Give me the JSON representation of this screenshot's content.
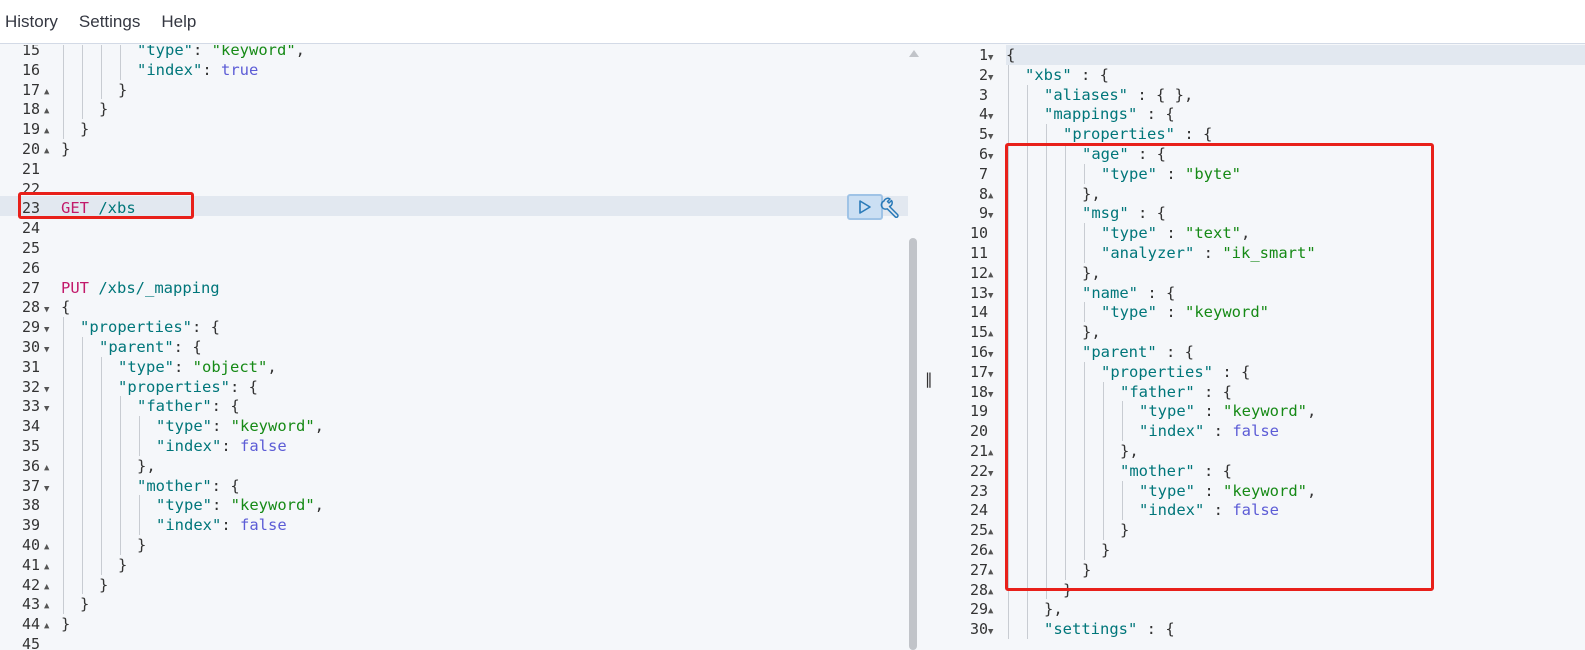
{
  "menubar": {
    "items": [
      "History",
      "Settings",
      "Help"
    ]
  },
  "colors": {
    "key": "#00767a",
    "string": "#168a16",
    "bool": "#5c5cd6",
    "method": "#c21a6b",
    "highlight_box": "#e8201a",
    "active_line": "#e2e8f0"
  },
  "left_editor": {
    "lines": [
      {
        "n": "15",
        "fold": "",
        "indent": 4,
        "tokens": [
          [
            "k",
            "\"type\""
          ],
          [
            "p",
            ": "
          ],
          [
            "s",
            "\"keyword\""
          ],
          [
            "p",
            ","
          ]
        ]
      },
      {
        "n": "16",
        "fold": "",
        "indent": 4,
        "tokens": [
          [
            "k",
            "\"index\""
          ],
          [
            "p",
            ": "
          ],
          [
            "b",
            "true"
          ]
        ]
      },
      {
        "n": "17",
        "fold": "up",
        "indent": 3,
        "tokens": [
          [
            "p",
            "}"
          ]
        ]
      },
      {
        "n": "18",
        "fold": "up",
        "indent": 2,
        "tokens": [
          [
            "p",
            "}"
          ]
        ]
      },
      {
        "n": "19",
        "fold": "up",
        "indent": 1,
        "tokens": [
          [
            "p",
            "}"
          ]
        ]
      },
      {
        "n": "20",
        "fold": "up",
        "indent": 0,
        "tokens": [
          [
            "p",
            "}"
          ]
        ]
      },
      {
        "n": "21",
        "fold": "",
        "indent": 0,
        "tokens": []
      },
      {
        "n": "22",
        "fold": "",
        "indent": 0,
        "tokens": []
      },
      {
        "n": "23",
        "fold": "",
        "indent": 0,
        "tokens": [
          [
            "m",
            "GET "
          ],
          [
            "u",
            "/xbs"
          ]
        ]
      },
      {
        "n": "24",
        "fold": "",
        "indent": 0,
        "tokens": []
      },
      {
        "n": "25",
        "fold": "",
        "indent": 0,
        "tokens": []
      },
      {
        "n": "26",
        "fold": "",
        "indent": 0,
        "tokens": []
      },
      {
        "n": "27",
        "fold": "",
        "indent": 0,
        "tokens": [
          [
            "m",
            "PUT "
          ],
          [
            "u",
            "/xbs/_mapping"
          ]
        ]
      },
      {
        "n": "28",
        "fold": "down",
        "indent": 0,
        "tokens": [
          [
            "p",
            "{"
          ]
        ]
      },
      {
        "n": "29",
        "fold": "down",
        "indent": 1,
        "tokens": [
          [
            "k",
            "\"properties\""
          ],
          [
            "p",
            ": {"
          ]
        ]
      },
      {
        "n": "30",
        "fold": "down",
        "indent": 2,
        "tokens": [
          [
            "k",
            "\"parent\""
          ],
          [
            "p",
            ": {"
          ]
        ]
      },
      {
        "n": "31",
        "fold": "",
        "indent": 3,
        "tokens": [
          [
            "k",
            "\"type\""
          ],
          [
            "p",
            ": "
          ],
          [
            "s",
            "\"object\""
          ],
          [
            "p",
            ","
          ]
        ]
      },
      {
        "n": "32",
        "fold": "down",
        "indent": 3,
        "tokens": [
          [
            "k",
            "\"properties\""
          ],
          [
            "p",
            ": {"
          ]
        ]
      },
      {
        "n": "33",
        "fold": "down",
        "indent": 4,
        "tokens": [
          [
            "k",
            "\"father\""
          ],
          [
            "p",
            ": {"
          ]
        ]
      },
      {
        "n": "34",
        "fold": "",
        "indent": 5,
        "tokens": [
          [
            "k",
            "\"type\""
          ],
          [
            "p",
            ": "
          ],
          [
            "s",
            "\"keyword\""
          ],
          [
            "p",
            ","
          ]
        ]
      },
      {
        "n": "35",
        "fold": "",
        "indent": 5,
        "tokens": [
          [
            "k",
            "\"index\""
          ],
          [
            "p",
            ": "
          ],
          [
            "b",
            "false"
          ]
        ]
      },
      {
        "n": "36",
        "fold": "up",
        "indent": 4,
        "tokens": [
          [
            "p",
            "},"
          ]
        ]
      },
      {
        "n": "37",
        "fold": "down",
        "indent": 4,
        "tokens": [
          [
            "k",
            "\"mother\""
          ],
          [
            "p",
            ": {"
          ]
        ]
      },
      {
        "n": "38",
        "fold": "",
        "indent": 5,
        "tokens": [
          [
            "k",
            "\"type\""
          ],
          [
            "p",
            ": "
          ],
          [
            "s",
            "\"keyword\""
          ],
          [
            "p",
            ","
          ]
        ]
      },
      {
        "n": "39",
        "fold": "",
        "indent": 5,
        "tokens": [
          [
            "k",
            "\"index\""
          ],
          [
            "p",
            ": "
          ],
          [
            "b",
            "false"
          ]
        ]
      },
      {
        "n": "40",
        "fold": "up",
        "indent": 4,
        "tokens": [
          [
            "p",
            "}"
          ]
        ]
      },
      {
        "n": "41",
        "fold": "up",
        "indent": 3,
        "tokens": [
          [
            "p",
            "}"
          ]
        ]
      },
      {
        "n": "42",
        "fold": "up",
        "indent": 2,
        "tokens": [
          [
            "p",
            "}"
          ]
        ]
      },
      {
        "n": "43",
        "fold": "up",
        "indent": 1,
        "tokens": [
          [
            "p",
            "}"
          ]
        ]
      },
      {
        "n": "44",
        "fold": "up",
        "indent": 0,
        "tokens": [
          [
            "p",
            "}"
          ]
        ]
      },
      {
        "n": "45",
        "fold": "",
        "indent": 0,
        "tokens": []
      }
    ]
  },
  "right_editor": {
    "lines": [
      {
        "n": "1",
        "fold": "down",
        "indent": 0,
        "tokens": [
          [
            "p",
            "{"
          ]
        ]
      },
      {
        "n": "2",
        "fold": "down",
        "indent": 1,
        "tokens": [
          [
            "k",
            "\"xbs\""
          ],
          [
            "p",
            " : {"
          ]
        ]
      },
      {
        "n": "3",
        "fold": "",
        "indent": 2,
        "tokens": [
          [
            "k",
            "\"aliases\""
          ],
          [
            "p",
            " : { },"
          ]
        ]
      },
      {
        "n": "4",
        "fold": "down",
        "indent": 2,
        "tokens": [
          [
            "k",
            "\"mappings\""
          ],
          [
            "p",
            " : {"
          ]
        ]
      },
      {
        "n": "5",
        "fold": "down",
        "indent": 3,
        "tokens": [
          [
            "k",
            "\"properties\""
          ],
          [
            "p",
            " : {"
          ]
        ]
      },
      {
        "n": "6",
        "fold": "down",
        "indent": 4,
        "tokens": [
          [
            "k",
            "\"age\""
          ],
          [
            "p",
            " : {"
          ]
        ]
      },
      {
        "n": "7",
        "fold": "",
        "indent": 5,
        "tokens": [
          [
            "k",
            "\"type\""
          ],
          [
            "p",
            " : "
          ],
          [
            "s",
            "\"byte\""
          ]
        ]
      },
      {
        "n": "8",
        "fold": "up",
        "indent": 4,
        "tokens": [
          [
            "p",
            "},"
          ]
        ]
      },
      {
        "n": "9",
        "fold": "down",
        "indent": 4,
        "tokens": [
          [
            "k",
            "\"msg\""
          ],
          [
            "p",
            " : {"
          ]
        ]
      },
      {
        "n": "10",
        "fold": "",
        "indent": 5,
        "tokens": [
          [
            "k",
            "\"type\""
          ],
          [
            "p",
            " : "
          ],
          [
            "s",
            "\"text\""
          ],
          [
            "p",
            ","
          ]
        ]
      },
      {
        "n": "11",
        "fold": "",
        "indent": 5,
        "tokens": [
          [
            "k",
            "\"analyzer\""
          ],
          [
            "p",
            " : "
          ],
          [
            "s",
            "\"ik_smart\""
          ]
        ]
      },
      {
        "n": "12",
        "fold": "up",
        "indent": 4,
        "tokens": [
          [
            "p",
            "},"
          ]
        ]
      },
      {
        "n": "13",
        "fold": "down",
        "indent": 4,
        "tokens": [
          [
            "k",
            "\"name\""
          ],
          [
            "p",
            " : {"
          ]
        ]
      },
      {
        "n": "14",
        "fold": "",
        "indent": 5,
        "tokens": [
          [
            "k",
            "\"type\""
          ],
          [
            "p",
            " : "
          ],
          [
            "s",
            "\"keyword\""
          ]
        ]
      },
      {
        "n": "15",
        "fold": "up",
        "indent": 4,
        "tokens": [
          [
            "p",
            "},"
          ]
        ]
      },
      {
        "n": "16",
        "fold": "down",
        "indent": 4,
        "tokens": [
          [
            "k",
            "\"parent\""
          ],
          [
            "p",
            " : {"
          ]
        ]
      },
      {
        "n": "17",
        "fold": "down",
        "indent": 5,
        "tokens": [
          [
            "k",
            "\"properties\""
          ],
          [
            "p",
            " : {"
          ]
        ]
      },
      {
        "n": "18",
        "fold": "down",
        "indent": 6,
        "tokens": [
          [
            "k",
            "\"father\""
          ],
          [
            "p",
            " : {"
          ]
        ]
      },
      {
        "n": "19",
        "fold": "",
        "indent": 7,
        "tokens": [
          [
            "k",
            "\"type\""
          ],
          [
            "p",
            " : "
          ],
          [
            "s",
            "\"keyword\""
          ],
          [
            "p",
            ","
          ]
        ]
      },
      {
        "n": "20",
        "fold": "",
        "indent": 7,
        "tokens": [
          [
            "k",
            "\"index\""
          ],
          [
            "p",
            " : "
          ],
          [
            "b",
            "false"
          ]
        ]
      },
      {
        "n": "21",
        "fold": "up",
        "indent": 6,
        "tokens": [
          [
            "p",
            "},"
          ]
        ]
      },
      {
        "n": "22",
        "fold": "down",
        "indent": 6,
        "tokens": [
          [
            "k",
            "\"mother\""
          ],
          [
            "p",
            " : {"
          ]
        ]
      },
      {
        "n": "23",
        "fold": "",
        "indent": 7,
        "tokens": [
          [
            "k",
            "\"type\""
          ],
          [
            "p",
            " : "
          ],
          [
            "s",
            "\"keyword\""
          ],
          [
            "p",
            ","
          ]
        ]
      },
      {
        "n": "24",
        "fold": "",
        "indent": 7,
        "tokens": [
          [
            "k",
            "\"index\""
          ],
          [
            "p",
            " : "
          ],
          [
            "b",
            "false"
          ]
        ]
      },
      {
        "n": "25",
        "fold": "up",
        "indent": 6,
        "tokens": [
          [
            "p",
            "}"
          ]
        ]
      },
      {
        "n": "26",
        "fold": "up",
        "indent": 5,
        "tokens": [
          [
            "p",
            "}"
          ]
        ]
      },
      {
        "n": "27",
        "fold": "up",
        "indent": 4,
        "tokens": [
          [
            "p",
            "}"
          ]
        ]
      },
      {
        "n": "28",
        "fold": "up",
        "indent": 3,
        "tokens": [
          [
            "p",
            "}"
          ]
        ]
      },
      {
        "n": "29",
        "fold": "up",
        "indent": 2,
        "tokens": [
          [
            "p",
            "},"
          ]
        ]
      },
      {
        "n": "30",
        "fold": "down",
        "indent": 2,
        "tokens": [
          [
            "k",
            "\"settings\""
          ],
          [
            "p",
            " : {"
          ]
        ]
      }
    ]
  },
  "actions": {
    "run_icon": "play-icon",
    "settings_icon": "wrench-icon"
  }
}
